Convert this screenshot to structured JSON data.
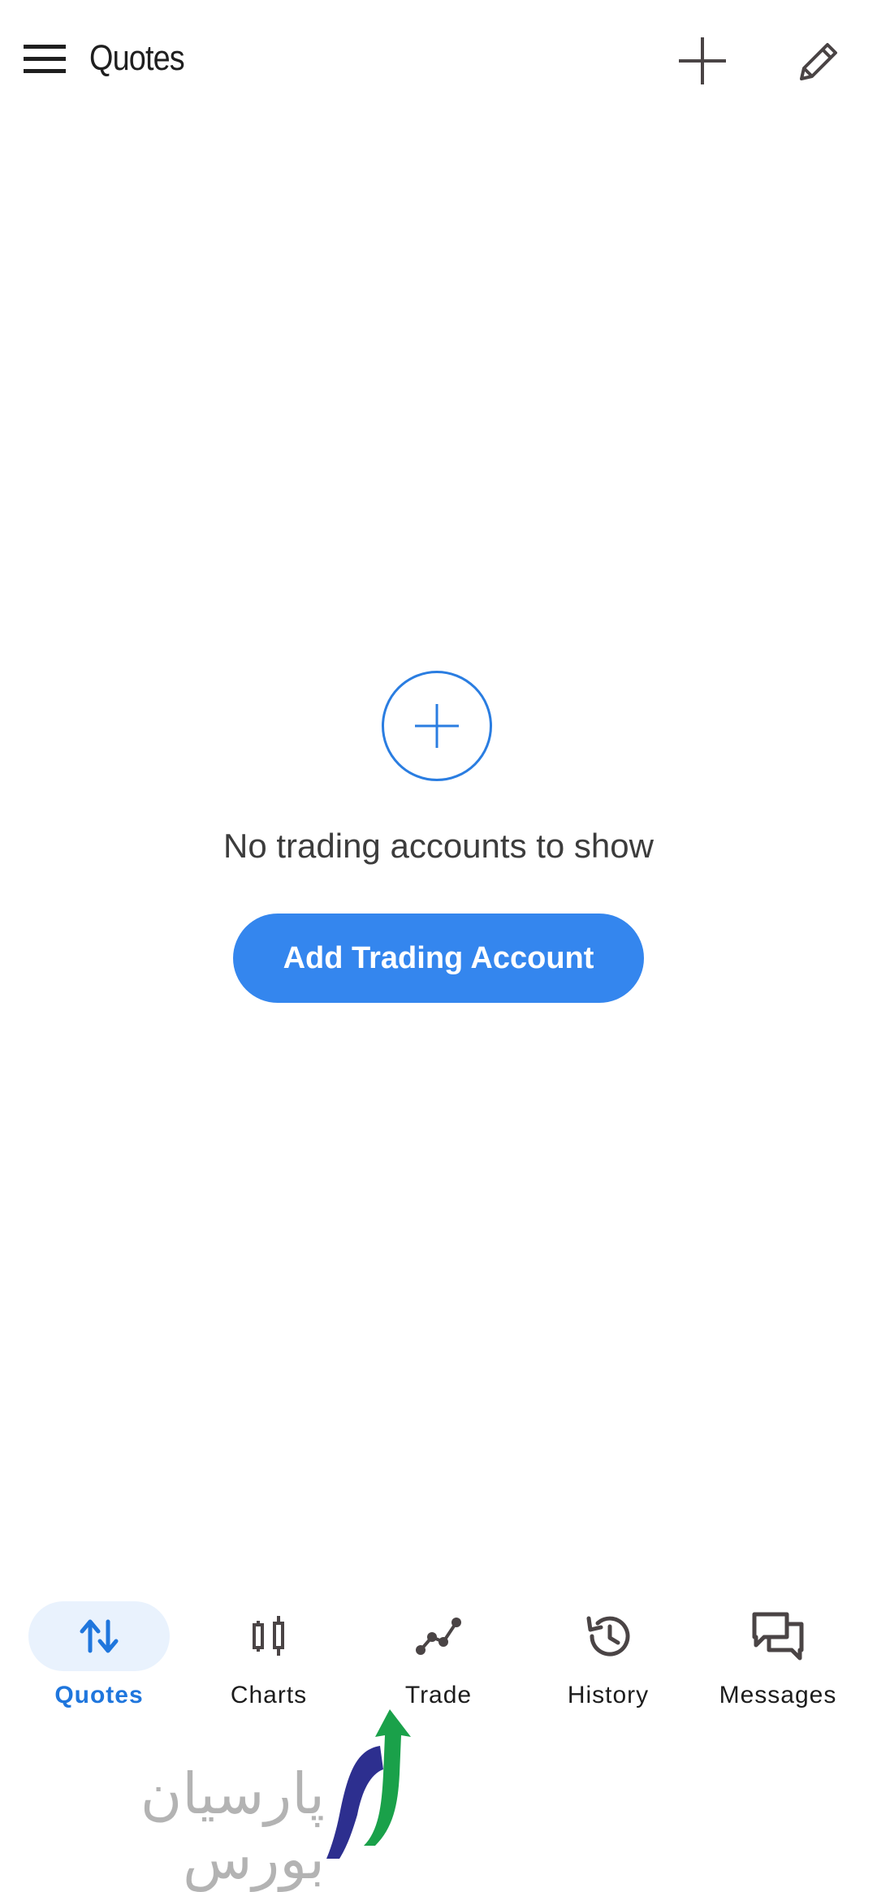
{
  "header": {
    "title": "Quotes",
    "menu_icon": "hamburger-menu-icon",
    "add_icon": "plus-icon",
    "edit_icon": "pencil-icon"
  },
  "empty_state": {
    "icon": "circle-plus-icon",
    "message": "No trading accounts to show",
    "button_label": "Add Trading Account"
  },
  "bottom_nav": {
    "items": [
      {
        "label": "Quotes",
        "icon": "arrows-up-down-icon",
        "active": true
      },
      {
        "label": "Charts",
        "icon": "candlestick-icon",
        "active": false
      },
      {
        "label": "Trade",
        "icon": "trend-line-icon",
        "active": false
      },
      {
        "label": "History",
        "icon": "history-clock-icon",
        "active": false
      },
      {
        "label": "Messages",
        "icon": "chat-bubbles-icon",
        "active": false
      }
    ]
  },
  "watermark": {
    "text": "پارسیان بورس"
  },
  "colors": {
    "accent": "#3486ee",
    "accent_dark": "#1f76dd",
    "active_pill": "#e9f2fd",
    "icon_dark": "#4a4445"
  }
}
